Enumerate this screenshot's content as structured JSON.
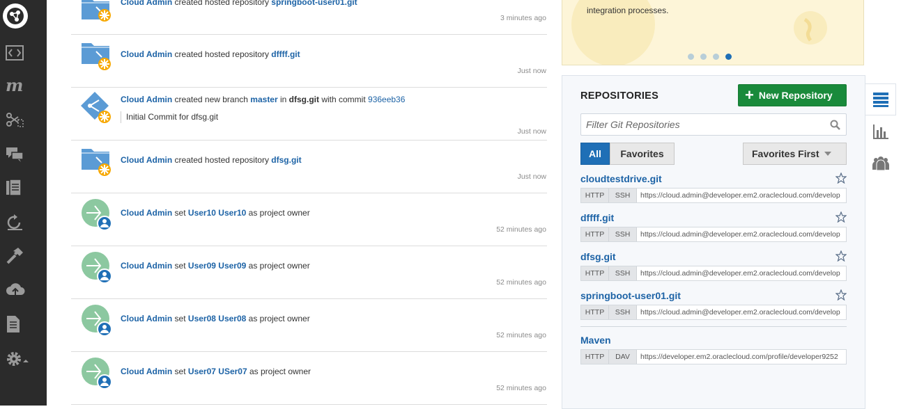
{
  "rail": {
    "items": [
      "logo-icon",
      "code-icon",
      "wiki-icon",
      "merge-requests-icon",
      "chat-icon",
      "issues-icon",
      "builds-icon",
      "hammer-icon",
      "deploy-icon",
      "docs-icon",
      "settings-icon"
    ]
  },
  "feed": [
    {
      "user": "Cloud Admin",
      "action": " created hosted repository ",
      "target": "springboot-user01.git",
      "time": "3 minutes ago",
      "kind": "repo"
    },
    {
      "user": "Cloud Admin",
      "action": " created hosted repository ",
      "target": "dffff.git",
      "time": "Just now",
      "kind": "repo"
    },
    {
      "user": "Cloud Admin",
      "action1": " created new branch ",
      "branch": "master",
      "action2": " in ",
      "repo": "dfsg.git",
      "action3": " with commit ",
      "commit": "936eeb36",
      "message": "Initial Commit for dfsg.git",
      "time": "Just now",
      "kind": "branch"
    },
    {
      "user": "Cloud Admin",
      "action": " created hosted repository ",
      "target": "dfsg.git",
      "time": "Just now",
      "kind": "repo"
    },
    {
      "user": "Cloud Admin",
      "action": " set ",
      "target": "User10 User10",
      "suffix": " as project owner",
      "time": "52 minutes ago",
      "kind": "owner"
    },
    {
      "user": "Cloud Admin",
      "action": " set ",
      "target": "User09 User09",
      "suffix": " as project owner",
      "time": "52 minutes ago",
      "kind": "owner"
    },
    {
      "user": "Cloud Admin",
      "action": " set ",
      "target": "User08 User08",
      "suffix": " as project owner",
      "time": "52 minutes ago",
      "kind": "owner"
    },
    {
      "user": "Cloud Admin",
      "action": " set ",
      "target": "User07 USer07",
      "suffix": " as project owner",
      "time": "52 minutes ago",
      "kind": "owner"
    }
  ],
  "banner": {
    "text": "integration processes.",
    "dots": 4,
    "active_dot": 4
  },
  "repositories": {
    "title": "REPOSITORIES",
    "new_button": "New Repository",
    "filter_placeholder": "Filter Git Repositories",
    "tabs": {
      "all": "All",
      "favorites": "Favorites"
    },
    "sort": "Favorites First",
    "items": [
      {
        "name": "cloudtestdrive.git",
        "p1": "HTTP",
        "p2": "SSH",
        "url": "https://cloud.admin@developer.em2.oraclecloud.com/develop"
      },
      {
        "name": "dffff.git",
        "p1": "HTTP",
        "p2": "SSH",
        "url": "https://cloud.admin@developer.em2.oraclecloud.com/develop"
      },
      {
        "name": "dfsg.git",
        "p1": "HTTP",
        "p2": "SSH",
        "url": "https://cloud.admin@developer.em2.oraclecloud.com/develop"
      },
      {
        "name": "springboot-user01.git",
        "p1": "HTTP",
        "p2": "SSH",
        "url": "https://cloud.admin@developer.em2.oraclecloud.com/develop"
      }
    ],
    "maven": {
      "name": "Maven",
      "p1": "HTTP",
      "p2": "DAV",
      "url": "https://developer.em2.oraclecloud.com/profile/developer9252"
    }
  },
  "side_tabs": [
    "repositories-list-icon",
    "statistics-icon",
    "team-icon"
  ],
  "colors": {
    "accent": "#1d63a6",
    "green": "#198a3b",
    "rail": "#2b2b2b"
  }
}
